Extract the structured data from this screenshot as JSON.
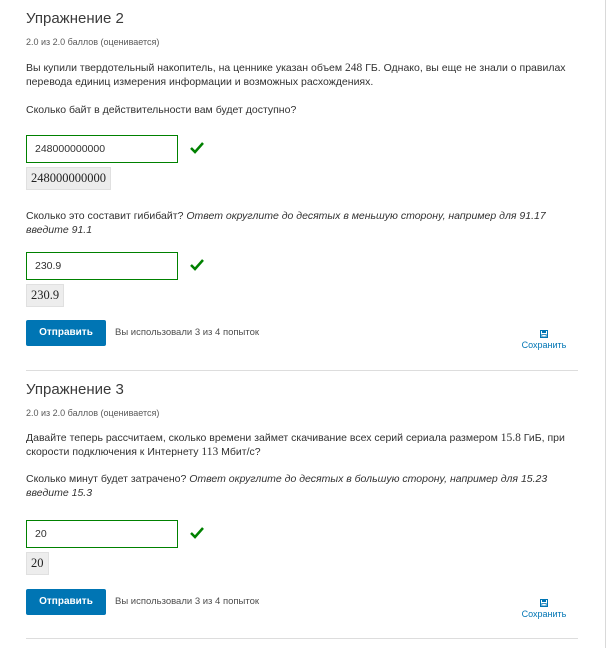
{
  "ex2": {
    "title": "Упражнение 2",
    "score": "2.0 из 2.0 баллов (оценивается)",
    "p1_a": "Вы купили твердотельный накопитель, на ценнике указан объем ",
    "p1_num": "248",
    "p1_b": " ГБ. Однако, вы еще не знали о правилах перевода единиц измерения информации и возможных расхождениях.",
    "q1": "Сколько байт в действительности вам будет доступно?",
    "a1_value": "248000000000",
    "a1_preview": "248000000000",
    "q2_a": "Сколько это составит гибибайт? ",
    "q2_hint": "Ответ округлите до десятых в меньшую сторону, например для 91.17 введите 91.1",
    "a2_value": "230.9",
    "a2_preview": "230.9",
    "submit": "Отправить",
    "attempts": "Вы использовали 3 из 4 попыток",
    "save": "Сохранить"
  },
  "ex3": {
    "title": "Упражнение 3",
    "score": "2.0 из 2.0 баллов (оценивается)",
    "p1_a": "Давайте теперь рассчитаем, сколько времени займет скачивание всех серий сериала размером ",
    "p1_num1": "15.8",
    "p1_b": " ГиБ, при скорости подключения к Интернету ",
    "p1_num2": "113",
    "p1_c": " Мбит/с?",
    "q1_a": "Сколько минут будет затрачено? ",
    "q1_hint": "Ответ округлите до десятых в большую сторону, например для 15.23 введите 15.3",
    "a1_value": "20",
    "a1_preview": "20",
    "submit": "Отправить",
    "attempts": "Вы использовали 3 из 4 попыток",
    "save": "Сохранить"
  },
  "colors": {
    "correct": "#008100",
    "accent": "#0075b4"
  },
  "icons": {
    "correct": "check-icon",
    "save": "save-icon"
  }
}
